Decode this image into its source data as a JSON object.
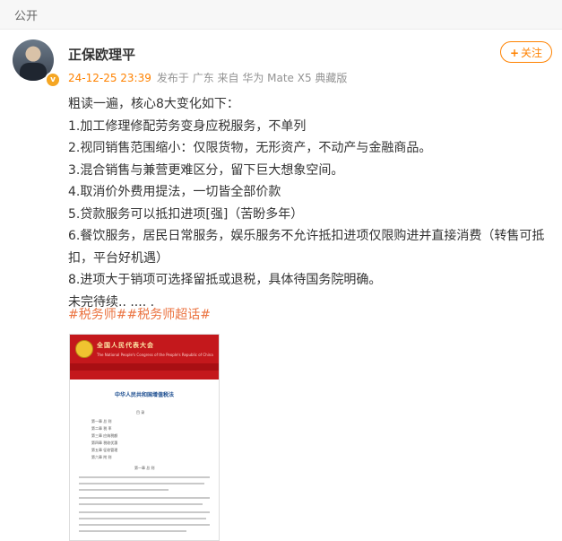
{
  "visibility": "公开",
  "user": {
    "name": "正保欧理平",
    "badge_icon": "verified-v-icon",
    "time": "24-12-25 23:39",
    "meta": "发布于 广东 来自 华为 Mate X5 典藏版"
  },
  "follow_button": {
    "label": "关注",
    "icon": "plus-icon"
  },
  "post": {
    "lines": [
      "粗读一遍，核心8大变化如下：",
      "1.加工修理修配劳务变身应税服务，不单列",
      "2.视同销售范围缩小：仅限货物，无形资产，不动产与金融商品。",
      "3.混合销售与兼营更难区分，留下巨大想象空间。",
      "4.取消价外费用提法，一切皆全部价款",
      "5.贷款服务可以抵扣进项[强]（苦盼多年）",
      "6.餐饮服务，居民日常服务，娱乐服务不允许抵扣进项仅限购进并直接消费（转售可抵扣，平台好机遇）",
      "8.进项大于销项可选择留抵或退税，具体待国务院明确。",
      "未完待续.. .... ."
    ],
    "tags": [
      "#税务师#",
      "#税务师超话#"
    ]
  },
  "image": {
    "header_title": "全国人民代表大会",
    "header_subtitle": "The National People's Congress of the People's Republic of China",
    "doc_title": "中华人民共和国增值税法",
    "contents_label": "目 录",
    "toc": [
      "第一章 总 则",
      "第二章 税 率",
      "第三章 应纳税额",
      "第四章 税收优惠",
      "第五章 征收管理",
      "第六章 附 则"
    ],
    "chapter1": "第一章 总 则"
  },
  "colors": {
    "accent": "#ff8200",
    "tag": "#eb7340",
    "brand_red": "#c4181c"
  }
}
